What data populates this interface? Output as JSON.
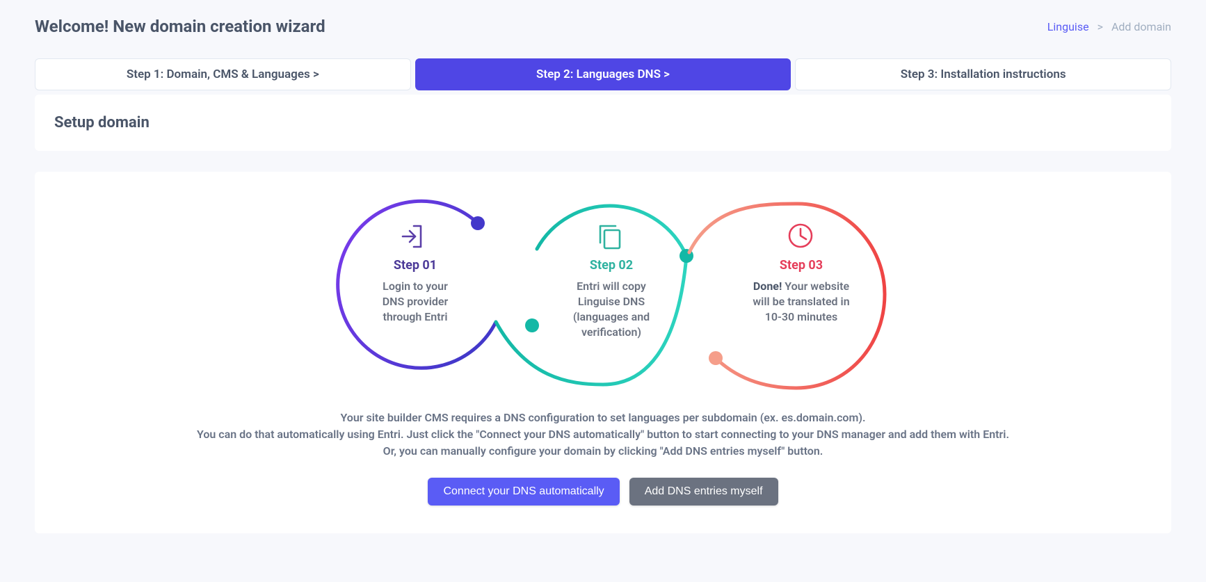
{
  "header": {
    "title": "Welcome! New domain creation wizard"
  },
  "breadcrumb": {
    "link": "Linguise",
    "sep": ">",
    "current": "Add domain"
  },
  "tabs": {
    "step1": "Step 1: Domain, CMS & Languages  >",
    "step2": "Step 2: Languages DNS  >",
    "step3": "Step 3: Installation instructions"
  },
  "section": {
    "title": "Setup domain"
  },
  "diagram": {
    "steps": [
      {
        "label": "Step 01",
        "line1": "Login to your",
        "line2": "DNS provider",
        "line3": "through Entri",
        "color_title": "#4c3a98"
      },
      {
        "label": "Step 02",
        "line1": "Entri will copy",
        "line2": "Linguise DNS",
        "line3": "(languages and",
        "line4": "verification)",
        "color_title": "#2fb2a0"
      },
      {
        "label": "Step 03",
        "bold": "Done!",
        "line1_rest": " Your website",
        "line2": "will be translated in",
        "line3": "10-30 minutes",
        "color_title": "#e53e5a"
      }
    ]
  },
  "description": {
    "line1": "Your site builder CMS requires a DNS configuration to set languages per subdomain (ex. es.domain.com).",
    "line2": "You can do that automatically using Entri. Just click the \"Connect your DNS automatically\" button to start connecting to your DNS manager and add them with Entri.",
    "line3": "Or, you can manually configure your domain by clicking \"Add DNS entries myself\" button."
  },
  "buttons": {
    "connect": "Connect your DNS automatically",
    "manual": "Add DNS entries myself"
  }
}
